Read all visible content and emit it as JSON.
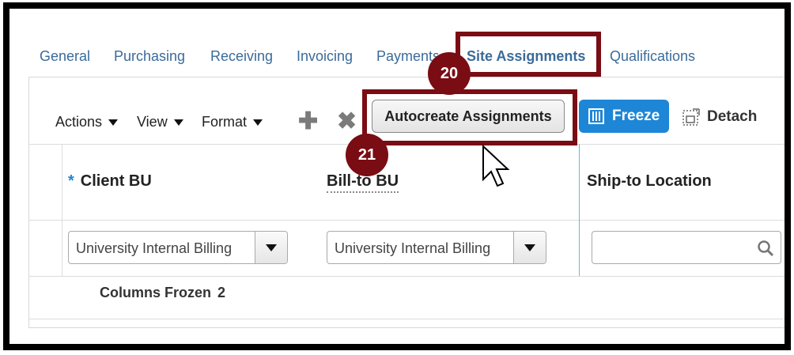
{
  "tabs": [
    {
      "label": "General"
    },
    {
      "label": "Purchasing"
    },
    {
      "label": "Receiving"
    },
    {
      "label": "Invoicing"
    },
    {
      "label": "Payments"
    },
    {
      "label": "Site Assignments",
      "active": true
    },
    {
      "label": "Qualifications"
    }
  ],
  "toolbar": {
    "actions_label": "Actions",
    "view_label": "View",
    "format_label": "Format",
    "add_icon": "plus-icon",
    "delete_icon": "close-icon",
    "autocreate_label": "Autocreate Assignments",
    "freeze_label": "Freeze",
    "detach_label": "Detach"
  },
  "table": {
    "columns": [
      {
        "label": "Client BU",
        "required": true,
        "required_mark": "*"
      },
      {
        "label": "Bill-to BU"
      },
      {
        "label": "Ship-to Location"
      }
    ],
    "row": {
      "client_bu_value": "University Internal Billing",
      "bill_to_bu_value": "University Internal Billing",
      "ship_to_location_value": ""
    }
  },
  "status": {
    "columns_frozen_label": "Columns Frozen",
    "columns_frozen_count": "2"
  },
  "annotations": {
    "step_20": "20",
    "step_21": "21",
    "highlight_color": "#7a0c13"
  },
  "colors": {
    "link": "#3a6b9a",
    "freeze_button": "#1e86d6",
    "frozen_divider": "#63b7e6"
  }
}
